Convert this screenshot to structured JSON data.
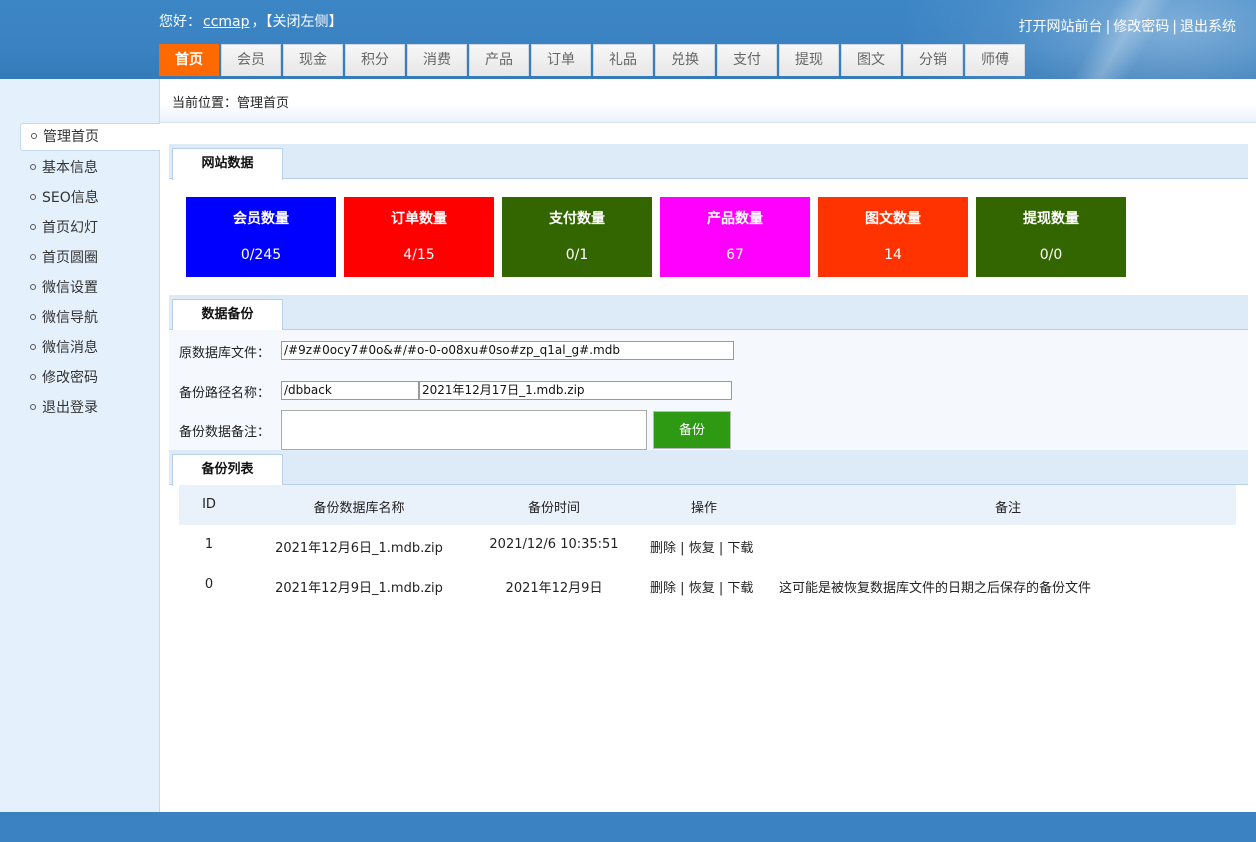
{
  "header": {
    "greeting": "您好：",
    "username": "ccmap",
    "comma": "，",
    "close_left": "【关闭左侧】",
    "links": [
      "打开网站前台",
      "修改密码",
      "退出系统"
    ],
    "separator": "|",
    "colors": {
      "bar": "#3a82c2",
      "active_tab": "#ff6a00"
    }
  },
  "nav": {
    "tabs": [
      "首页",
      "会员",
      "现金",
      "积分",
      "消费",
      "产品",
      "订单",
      "礼品",
      "兑换",
      "支付",
      "提现",
      "图文",
      "分销",
      "师傅"
    ],
    "active": "首页"
  },
  "breadcrumb": {
    "label": "当前位置：",
    "current": "管理首页"
  },
  "sidebar": {
    "items": [
      "管理首页",
      "基本信息",
      "SEO信息",
      "首页幻灯",
      "首页圆圈",
      "微信设置",
      "微信导航",
      "微信消息",
      "修改密码",
      "退出登录"
    ],
    "active": "管理首页"
  },
  "site_data": {
    "title": "网站数据",
    "stats": [
      {
        "label": "会员数量",
        "value": "0/245",
        "color": "#0000ff"
      },
      {
        "label": "订单数量",
        "value": "4/15",
        "color": "#ff0000"
      },
      {
        "label": "支付数量",
        "value": "0/1",
        "color": "#336600"
      },
      {
        "label": "产品数量",
        "value": "67",
        "color": "#ff00ff"
      },
      {
        "label": "图文数量",
        "value": "14",
        "color": "#ff3300"
      },
      {
        "label": "提现数量",
        "value": "0/0",
        "color": "#336600"
      }
    ]
  },
  "backup": {
    "title": "数据备份",
    "source_label": "原数据库文件：",
    "source_value": "/#9z#0ocy7#0o&#/#o-0-o08xu#0so#zp_q1al_g#.mdb",
    "path_label": "备份路径名称：",
    "path_value": "/dbback",
    "name_value": "2021年12月17日_1.mdb.zip",
    "note_label": "备份数据备注：",
    "note_value": "",
    "button": "备份",
    "button_color": "#2e9a14"
  },
  "backup_list": {
    "title": "备份列表",
    "columns": [
      "ID",
      "备份数据库名称",
      "备份时间",
      "操作",
      "备注"
    ],
    "rows": [
      {
        "id": "1",
        "name": "2021年12月6日_1.mdb.zip",
        "time": "2021/12/6 10:35:51",
        "ops": [
          "删除",
          "恢复",
          "下载"
        ],
        "note": ""
      },
      {
        "id": "0",
        "name": "2021年12月9日_1.mdb.zip",
        "time": "2021年12月9日",
        "ops": [
          "删除",
          "恢复",
          "下载"
        ],
        "note": "这可能是被恢复数据库文件的日期之后保存的备份文件"
      }
    ]
  }
}
